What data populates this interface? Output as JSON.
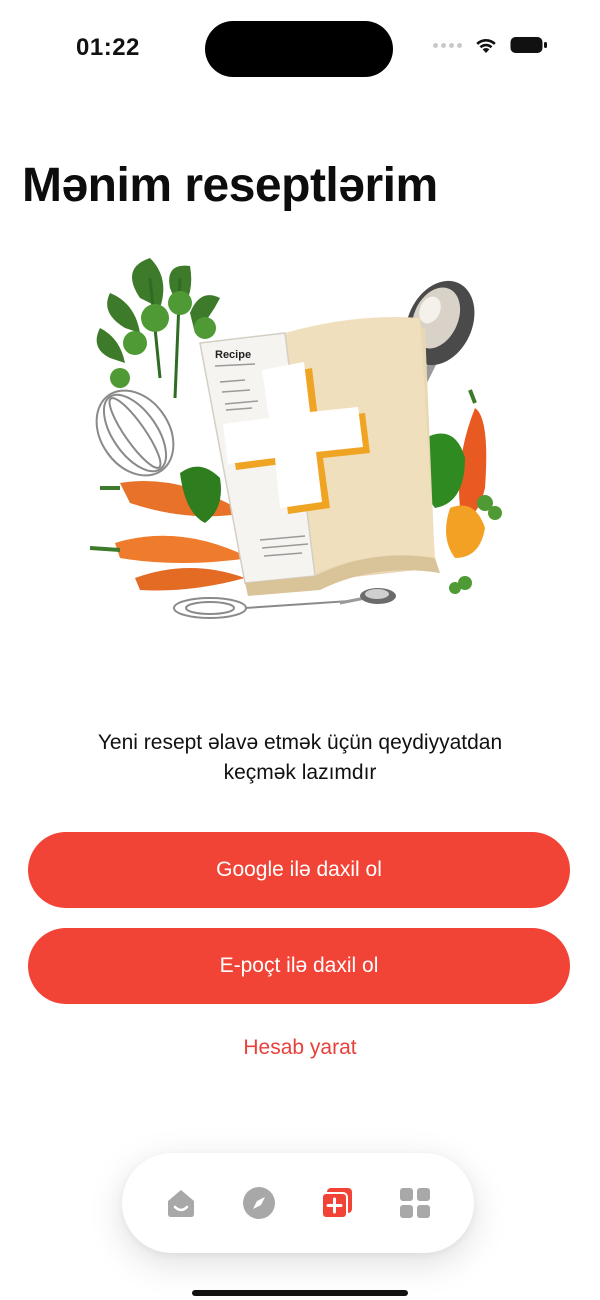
{
  "status_bar": {
    "time": "01:22"
  },
  "page": {
    "title": "Mənim reseptlərim"
  },
  "illustration": {
    "book_label": "Recipe",
    "icon": "recipe-book-plus-illustration"
  },
  "auth": {
    "message_line1": "Yeni resept əlavə etmək üçün qeydiyyatdan",
    "message_line2": "keçmək lazımdır",
    "google_button": "Google ilə daxil ol",
    "email_button": "E-poçt ilə daxil ol",
    "create_account_link": "Hesab yarat"
  },
  "tab_bar": {
    "tabs": [
      {
        "icon": "home-icon",
        "active": false
      },
      {
        "icon": "compass-icon",
        "active": false
      },
      {
        "icon": "add-recipe-icon",
        "active": true
      },
      {
        "icon": "grid-icon",
        "active": false
      }
    ]
  },
  "colors": {
    "accent": "#f24436",
    "link": "#e8403a",
    "tab_inactive": "#a8a8a8"
  }
}
